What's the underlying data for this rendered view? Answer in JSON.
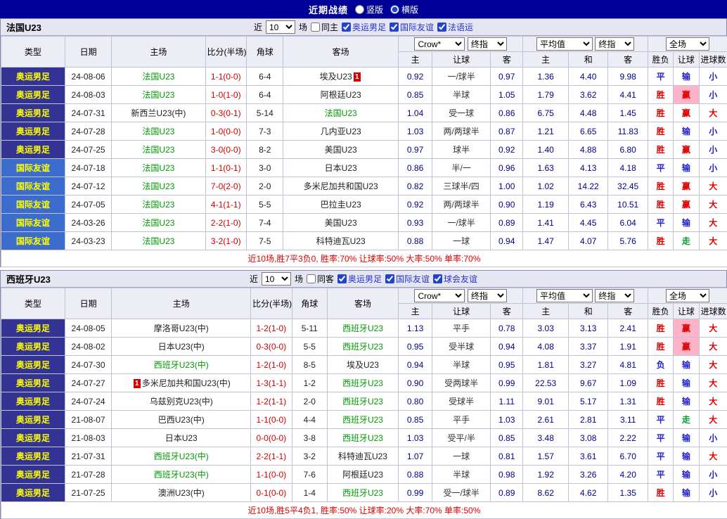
{
  "topbar": {
    "title": "近期战绩",
    "radios": [
      {
        "label": "竖版",
        "checked": false
      },
      {
        "label": "横版",
        "checked": true
      }
    ]
  },
  "columns": {
    "type": "类型",
    "date": "日期",
    "home": "主场",
    "score": "比分(半场)",
    "corner": "角球",
    "away": "客场",
    "h": "主",
    "handicap": "让球",
    "a": "客",
    "avg_h": "主",
    "draw": "和",
    "avg_a": "客",
    "wl": "胜负",
    "handicap2": "让球",
    "goals": "进球数"
  },
  "selects": {
    "book": "Crow*",
    "final": "终指",
    "avg": "平均值",
    "full": "全场"
  },
  "colors": {
    "topbar_bg": "#000099",
    "olympic_bg": "#333394",
    "friendly_bg": "#3d6dcc",
    "type_text": "#ffff00",
    "team_green": "#009900",
    "score_red": "#d40000",
    "odds_navy": "#00008b",
    "result_red": "#e00000",
    "result_blue": "#2222cc",
    "result_green": "#009933",
    "highlight_pink": "#ffb3c8",
    "summary_red": "#e00000"
  },
  "sections": [
    {
      "team": "法国U23",
      "filter": {
        "near": "近",
        "count": "10",
        "games": "场",
        "same": {
          "label": "同主",
          "checked": false
        },
        "comps": [
          {
            "label": "奥运男足",
            "checked": true
          },
          {
            "label": "国际友谊",
            "checked": true
          },
          {
            "label": "法语运",
            "checked": true
          }
        ]
      },
      "rows": [
        {
          "type": "奥运男足",
          "date": "24-08-06",
          "home": "法国U23",
          "home_green": true,
          "score": "1-1(0-0)",
          "corners": "6-4",
          "away": "埃及U23",
          "away_badge": "1",
          "odds": [
            "0.92",
            "一/球半",
            "0.97"
          ],
          "avg": [
            "1.36",
            "4.40",
            "9.98"
          ],
          "results": [
            "平",
            "输",
            "小"
          ],
          "hl": false
        },
        {
          "type": "奥运男足",
          "date": "24-08-03",
          "home": "法国U23",
          "home_green": true,
          "score": "1-0(1-0)",
          "corners": "6-4",
          "away": "阿根廷U23",
          "odds": [
            "0.85",
            "半球",
            "1.05"
          ],
          "avg": [
            "1.79",
            "3.62",
            "4.41"
          ],
          "results": [
            "胜",
            "赢",
            "小"
          ],
          "hl": true
        },
        {
          "type": "奥运男足",
          "date": "24-07-31",
          "home": "新西兰U23(中)",
          "score": "0-3(0-1)",
          "corners": "5-14",
          "away": "法国U23",
          "away_green": true,
          "odds": [
            "1.04",
            "受一球",
            "0.86"
          ],
          "avg": [
            "6.75",
            "4.48",
            "1.45"
          ],
          "results": [
            "胜",
            "赢",
            "大"
          ],
          "hl": false
        },
        {
          "type": "奥运男足",
          "date": "24-07-28",
          "home": "法国U23",
          "home_green": true,
          "score": "1-0(0-0)",
          "corners": "7-3",
          "away": "几内亚U23",
          "odds": [
            "1.03",
            "两/两球半",
            "0.87"
          ],
          "avg": [
            "1.21",
            "6.65",
            "11.83"
          ],
          "results": [
            "胜",
            "输",
            "小"
          ],
          "hl": false
        },
        {
          "type": "奥运男足",
          "date": "24-07-25",
          "home": "法国U23",
          "home_green": true,
          "score": "3-0(0-0)",
          "corners": "8-2",
          "away": "美国U23",
          "odds": [
            "0.97",
            "球半",
            "0.92"
          ],
          "avg": [
            "1.40",
            "4.88",
            "6.80"
          ],
          "results": [
            "胜",
            "赢",
            "小"
          ],
          "hl": false
        },
        {
          "type": "国际友谊",
          "date": "24-07-18",
          "home": "法国U23",
          "home_green": true,
          "score": "1-1(0-1)",
          "corners": "3-0",
          "away": "日本U23",
          "odds": [
            "0.86",
            "半/一",
            "0.96"
          ],
          "avg": [
            "1.63",
            "4.13",
            "4.18"
          ],
          "results": [
            "平",
            "输",
            "小"
          ],
          "hl": false
        },
        {
          "type": "国际友谊",
          "date": "24-07-12",
          "home": "法国U23",
          "home_green": true,
          "score": "7-0(2-0)",
          "corners": "2-0",
          "away": "多米尼加共和国U23",
          "odds": [
            "0.82",
            "三球半/四",
            "1.00"
          ],
          "avg": [
            "1.02",
            "14.22",
            "32.45"
          ],
          "results": [
            "胜",
            "赢",
            "大"
          ],
          "hl": false
        },
        {
          "type": "国际友谊",
          "date": "24-07-05",
          "home": "法国U23",
          "home_green": true,
          "score": "4-1(1-1)",
          "corners": "5-5",
          "away": "巴拉圭U23",
          "odds": [
            "0.92",
            "两/两球半",
            "0.90"
          ],
          "avg": [
            "1.19",
            "6.43",
            "10.51"
          ],
          "results": [
            "胜",
            "赢",
            "大"
          ],
          "hl": false
        },
        {
          "type": "国际友谊",
          "date": "24-03-26",
          "home": "法国U23",
          "home_green": true,
          "score": "2-2(1-0)",
          "corners": "7-4",
          "away": "美国U23",
          "odds": [
            "0.93",
            "一/球半",
            "0.89"
          ],
          "avg": [
            "1.41",
            "4.45",
            "6.04"
          ],
          "results": [
            "平",
            "输",
            "大"
          ],
          "hl": false
        },
        {
          "type": "国际友谊",
          "date": "24-03-23",
          "home": "法国U23",
          "home_green": true,
          "score": "3-2(1-0)",
          "corners": "7-5",
          "away": "科特迪瓦U23",
          "odds": [
            "0.88",
            "一球",
            "0.94"
          ],
          "avg": [
            "1.47",
            "4.07",
            "5.76"
          ],
          "results": [
            "胜",
            "走",
            "大"
          ],
          "hl": false
        }
      ],
      "footer": "近10场,胜7平3负0, 胜率:70% 让球率:50% 大率:50% 单率:70%"
    },
    {
      "team": "西班牙U23",
      "filter": {
        "near": "近",
        "count": "10",
        "games": "场",
        "same": {
          "label": "同客",
          "checked": false
        },
        "comps": [
          {
            "label": "奥运男足",
            "checked": true
          },
          {
            "label": "国际友谊",
            "checked": true
          },
          {
            "label": "球会友谊",
            "checked": true
          }
        ]
      },
      "rows": [
        {
          "type": "奥运男足",
          "date": "24-08-05",
          "home": "摩洛哥U23(中)",
          "score": "1-2(1-0)",
          "corners": "5-11",
          "away": "西班牙U23",
          "away_green": true,
          "odds": [
            "1.13",
            "平手",
            "0.78"
          ],
          "avg": [
            "3.03",
            "3.13",
            "2.41"
          ],
          "results": [
            "胜",
            "赢",
            "大"
          ],
          "hl": true
        },
        {
          "type": "奥运男足",
          "date": "24-08-02",
          "home": "日本U23(中)",
          "score": "0-3(0-0)",
          "corners": "5-5",
          "away": "西班牙U23",
          "away_green": true,
          "odds": [
            "0.95",
            "受半球",
            "0.94"
          ],
          "avg": [
            "4.08",
            "3.37",
            "1.91"
          ],
          "results": [
            "胜",
            "赢",
            "大"
          ],
          "hl": true
        },
        {
          "type": "奥运男足",
          "date": "24-07-30",
          "home": "西班牙U23(中)",
          "home_green": true,
          "score": "1-2(1-0)",
          "corners": "8-5",
          "away": "埃及U23",
          "odds": [
            "0.94",
            "半球",
            "0.95"
          ],
          "avg": [
            "1.81",
            "3.27",
            "4.81"
          ],
          "results": [
            "负",
            "输",
            "大"
          ],
          "hl": false
        },
        {
          "type": "奥运男足",
          "date": "24-07-27",
          "home": "多米尼加共和国U23(中)",
          "home_badge": "1",
          "score": "1-3(1-1)",
          "corners": "1-2",
          "away": "西班牙U23",
          "away_green": true,
          "odds": [
            "0.90",
            "受两球半",
            "0.99"
          ],
          "avg": [
            "22.53",
            "9.67",
            "1.09"
          ],
          "results": [
            "胜",
            "输",
            "大"
          ],
          "hl": false
        },
        {
          "type": "奥运男足",
          "date": "24-07-24",
          "home": "乌兹别克U23(中)",
          "score": "1-2(1-1)",
          "corners": "2-0",
          "away": "西班牙U23",
          "away_green": true,
          "odds": [
            "0.80",
            "受球半",
            "1.11"
          ],
          "avg": [
            "9.01",
            "5.17",
            "1.31"
          ],
          "results": [
            "胜",
            "输",
            "大"
          ],
          "hl": false
        },
        {
          "type": "奥运男足",
          "date": "21-08-07",
          "home": "巴西U23(中)",
          "score": "1-1(0-0)",
          "corners": "4-4",
          "away": "西班牙U23",
          "away_green": true,
          "odds": [
            "0.85",
            "平手",
            "1.03"
          ],
          "avg": [
            "2.61",
            "2.81",
            "3.11"
          ],
          "results": [
            "平",
            "走",
            "大"
          ],
          "hl": false
        },
        {
          "type": "奥运男足",
          "date": "21-08-03",
          "home": "日本U23",
          "score": "0-0(0-0)",
          "corners": "3-8",
          "away": "西班牙U23",
          "away_green": true,
          "odds": [
            "1.03",
            "受平/半",
            "0.85"
          ],
          "avg": [
            "3.48",
            "3.08",
            "2.22"
          ],
          "results": [
            "平",
            "输",
            "小"
          ],
          "hl": false
        },
        {
          "type": "奥运男足",
          "date": "21-07-31",
          "home": "西班牙U23(中)",
          "home_green": true,
          "score": "2-2(1-1)",
          "corners": "3-2",
          "away": "科特迪瓦U23",
          "odds": [
            "1.07",
            "一球",
            "0.81"
          ],
          "avg": [
            "1.57",
            "3.61",
            "6.70"
          ],
          "results": [
            "平",
            "输",
            "大"
          ],
          "hl": false
        },
        {
          "type": "奥运男足",
          "date": "21-07-28",
          "home": "西班牙U23(中)",
          "home_green": true,
          "score": "1-1(0-0)",
          "corners": "7-6",
          "away": "阿根廷U23",
          "odds": [
            "0.88",
            "半球",
            "0.98"
          ],
          "avg": [
            "1.92",
            "3.26",
            "4.20"
          ],
          "results": [
            "平",
            "输",
            "小"
          ],
          "hl": false
        },
        {
          "type": "奥运男足",
          "date": "21-07-25",
          "home": "澳洲U23(中)",
          "score": "0-1(0-0)",
          "corners": "1-4",
          "away": "西班牙U23",
          "away_green": true,
          "odds": [
            "0.99",
            "受一/球半",
            "0.89"
          ],
          "avg": [
            "8.62",
            "4.62",
            "1.35"
          ],
          "results": [
            "胜",
            "输",
            "小"
          ],
          "hl": false
        }
      ],
      "footer": "近10场,胜5平4负1, 胜率:50% 让球率:20% 大率:70% 单率:50%"
    }
  ]
}
